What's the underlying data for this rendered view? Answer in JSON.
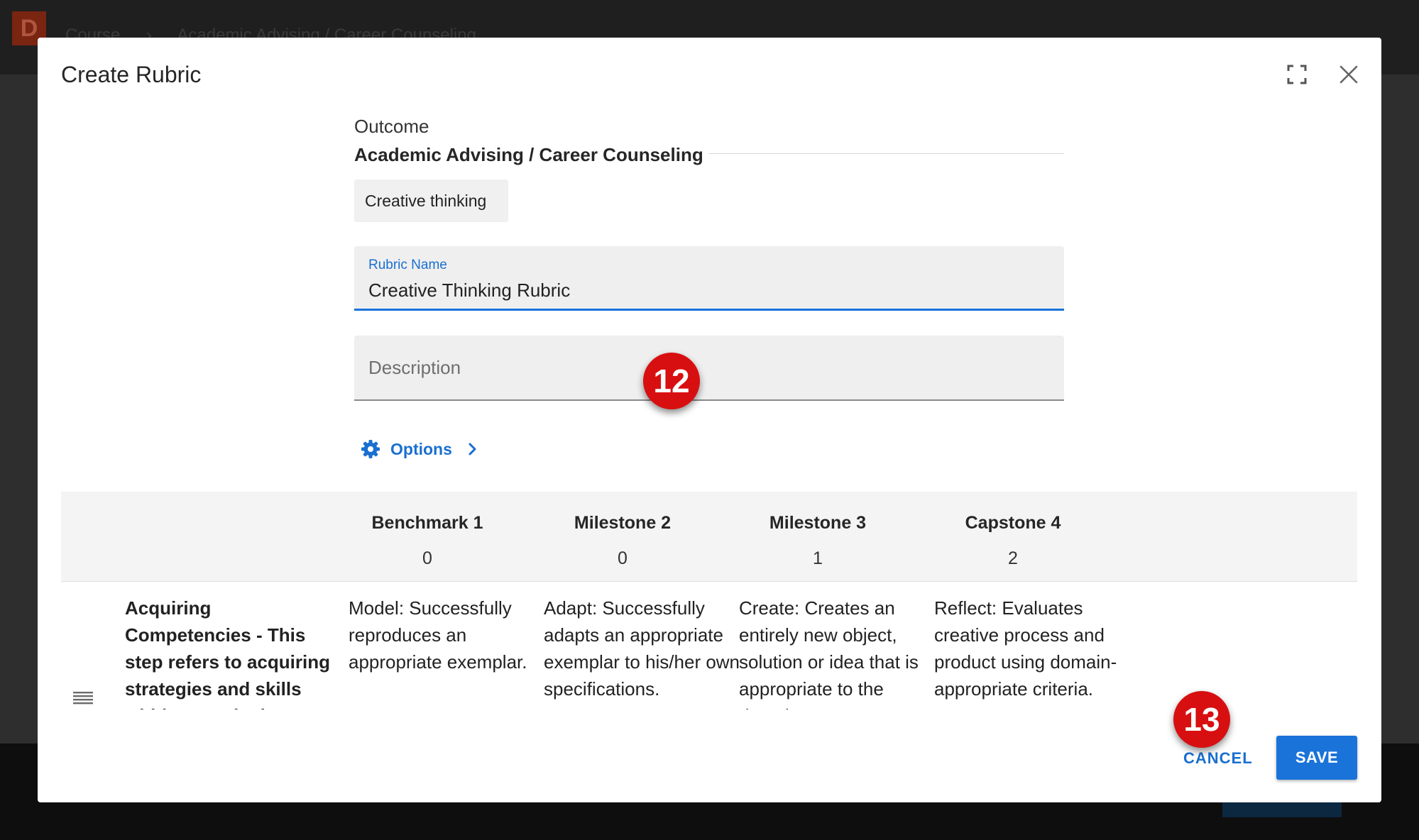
{
  "background": {
    "logo_letter": "D",
    "breadcrumb": [
      "Course",
      "›",
      "Academic Advising / Career Counseling"
    ]
  },
  "dialog": {
    "title": "Create Rubric",
    "outcome_label": "Outcome",
    "outcome_name": "Academic Advising / Career Counseling",
    "chip": "Creative thinking",
    "rubric_name_label": "Rubric Name",
    "rubric_name_value": "Creative Thinking Rubric",
    "description_placeholder": "Description",
    "options_label": "Options",
    "cancel_label": "CANCEL",
    "save_label": "SAVE"
  },
  "markers": {
    "step12": "12",
    "step13": "13"
  },
  "rubric": {
    "columns": [
      {
        "name": "Benchmark 1",
        "points": "0"
      },
      {
        "name": "Milestone 2",
        "points": "0"
      },
      {
        "name": "Milestone 3",
        "points": "1"
      },
      {
        "name": "Capstone 4",
        "points": "2"
      }
    ],
    "rows": [
      {
        "criterion": "Acquiring Competencies - This step refers to acquiring strategies and skills within a particular domain.",
        "cells": [
          "Model: Successfully reproduces an appropriate exemplar.",
          "Adapt: Successfully adapts an appropriate exemplar to his/her own specifications.",
          "Create: Creates an entirely new object, solution or idea that is appropriate to the domain.",
          "Reflect: Evaluates creative process and product using domain-appropriate criteria."
        ]
      }
    ]
  },
  "colors": {
    "accent": "#1a73d9",
    "marker": "#d80f10",
    "dialog_bg": "#ffffff",
    "overlay": "#0e0e0e"
  },
  "icons": [
    "fullscreen-icon",
    "close-icon",
    "gear-icon",
    "chevron-right-icon",
    "drag-handle-icon"
  ]
}
